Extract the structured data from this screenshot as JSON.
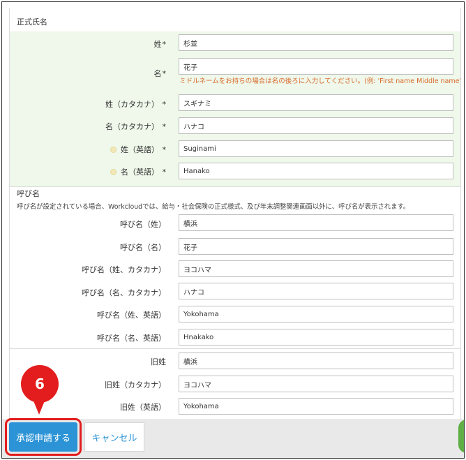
{
  "legal_name": {
    "section_title": "正式氏名",
    "hint": "ミドルネームをお持ちの場合は名の後ろに入力してください。(例: 'First name Middle name')",
    "fields": [
      {
        "label": "姓",
        "required": "*",
        "value": ""
      },
      {
        "label": "名",
        "required": "*",
        "value": ""
      },
      {
        "label": "姓（カタカナ）",
        "required": " *",
        "value": ""
      },
      {
        "label": "名（カタカナ）",
        "required": " *",
        "value": ""
      },
      {
        "label": "姓（英語）",
        "required": " *",
        "value": ""
      },
      {
        "label": "名（英語）",
        "required": " *",
        "value": ""
      }
    ],
    "values": [
      "杉並",
      "花子",
      "スギナミ",
      "ハナコ",
      "Suginami",
      "Hanako"
    ]
  },
  "nickname": {
    "section_title": "呼び名",
    "description": "呼び名が設定されている場合、Workcloudでは、給与・社会保険の正式様式、及び年末調整関連画面以外に、呼び名が表示されます。",
    "fields": [
      {
        "label": "呼び名（姓）",
        "value": "横浜"
      },
      {
        "label": "呼び名（名）",
        "value": "花子"
      },
      {
        "label": "呼び名（姓、カタカナ）",
        "value": "ヨコハマ"
      },
      {
        "label": "呼び名（名、カタカナ）",
        "value": "ハナコ"
      },
      {
        "label": "呼び名（姓、英語）",
        "value": "Yokohama"
      },
      {
        "label": "呼び名（名、英語）",
        "value": "Hnakako"
      }
    ]
  },
  "former_name": {
    "fields": [
      {
        "label": "旧姓",
        "value": "横浜"
      },
      {
        "label": "旧姓（カタカナ）",
        "value": "ヨコハマ"
      },
      {
        "label": "旧姓（英語）",
        "value": "Yokohama"
      }
    ]
  },
  "footer": {
    "approve_label": "承認申請する",
    "cancel_label": "キャンセル"
  },
  "annotation": {
    "step_number": "6"
  },
  "colors": {
    "primary": "#2b93d6",
    "highlight_bg": "#eff8ea",
    "hint": "#d9692b",
    "annotation_red": "#e31d1d"
  }
}
